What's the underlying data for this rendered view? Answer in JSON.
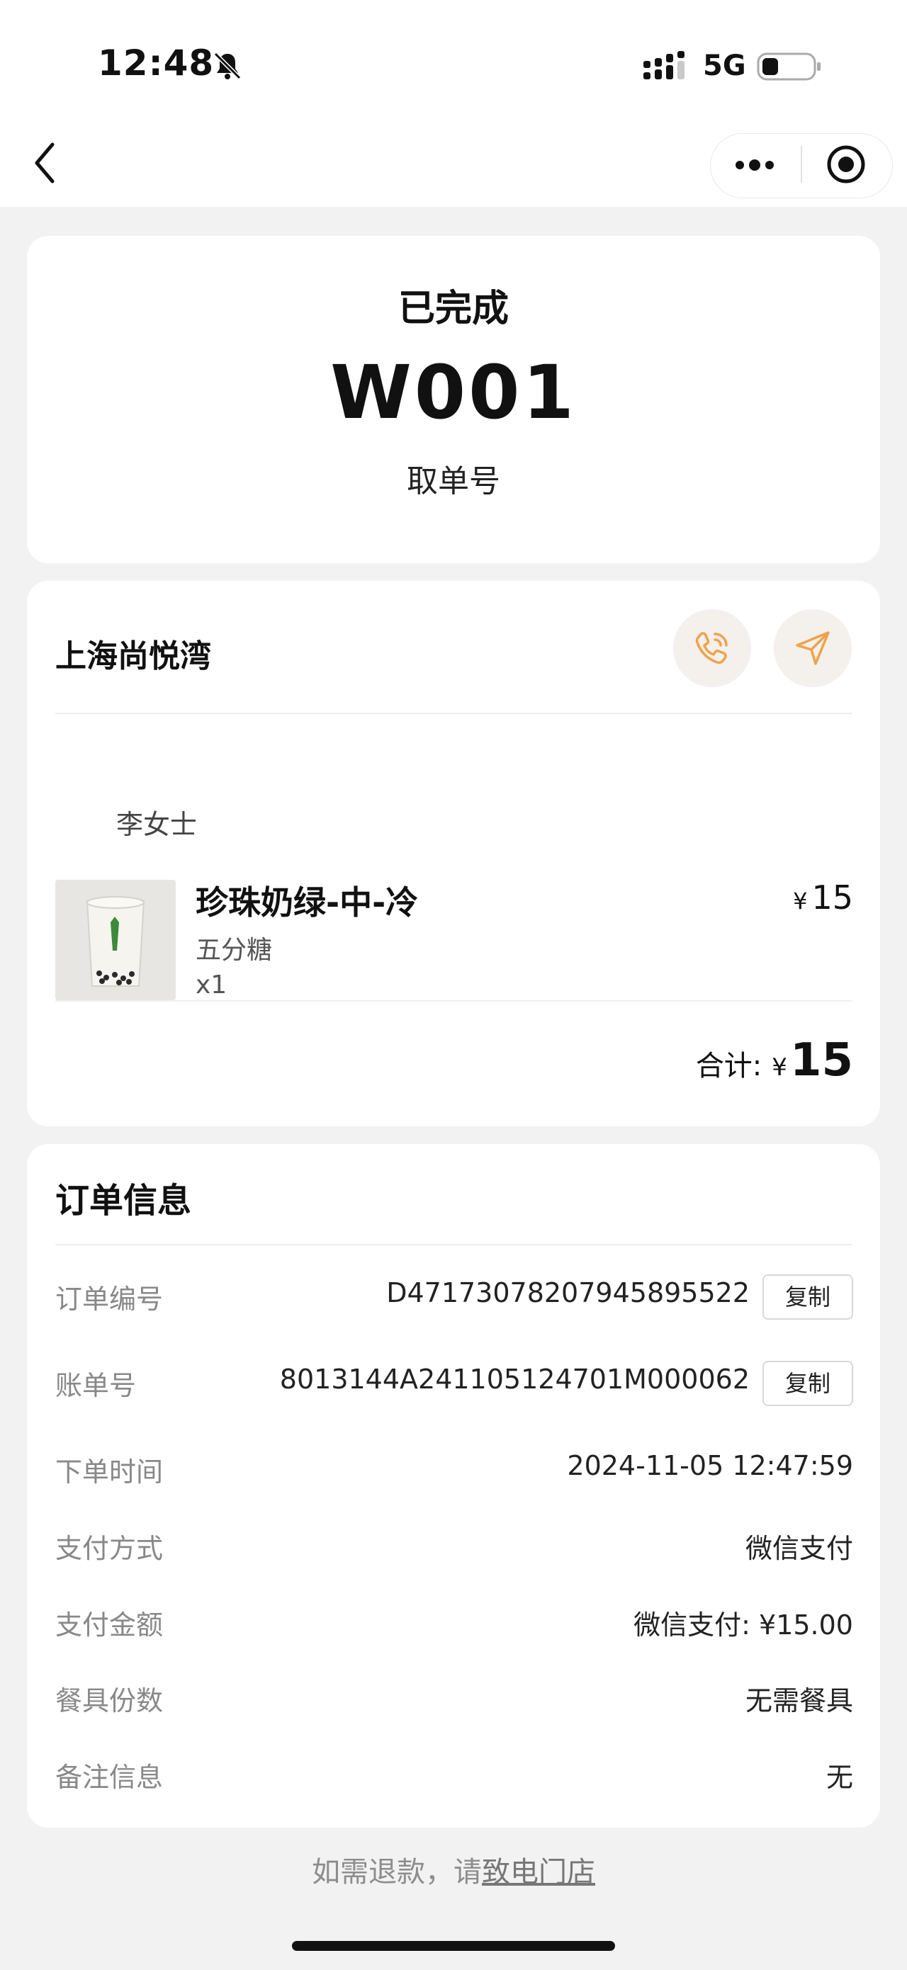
{
  "status_bar": {
    "time": "12:48",
    "network": "5G"
  },
  "nav": {
    "back_icon": "chevron-left-icon",
    "more_icon": "more-dots-icon",
    "close_icon": "target-circle-icon"
  },
  "order_status": {
    "status": "已完成",
    "pickup_number": "W001",
    "pickup_label": "取单号"
  },
  "store": {
    "name": "上海尚悦湾",
    "customer": "李女士",
    "item": {
      "name": "珍珠奶绿-中-冷",
      "spec": "五分糖",
      "qty": "x1",
      "currency": "¥",
      "price": "15"
    },
    "total_label": "合计:",
    "total_currency": "¥",
    "total_amount": "15",
    "accent_color": "#f0a24a"
  },
  "order_info": {
    "title": "订单信息",
    "copy_label": "复制",
    "rows": [
      {
        "label": "订单编号",
        "value": "D47173078207945895522"
      },
      {
        "label": "账单号",
        "value": "8013144A241105124701M000062"
      },
      {
        "label": "下单时间",
        "value": "2024-11-05 12:47:59"
      },
      {
        "label": "支付方式",
        "value": "微信支付"
      },
      {
        "label": "支付金额",
        "value": "微信支付: ¥15.00"
      },
      {
        "label": "餐具份数",
        "value": "无需餐具"
      },
      {
        "label": "备注信息",
        "value": "无"
      }
    ]
  },
  "footer": {
    "text": "如需退款，请",
    "link": "致电门店"
  }
}
